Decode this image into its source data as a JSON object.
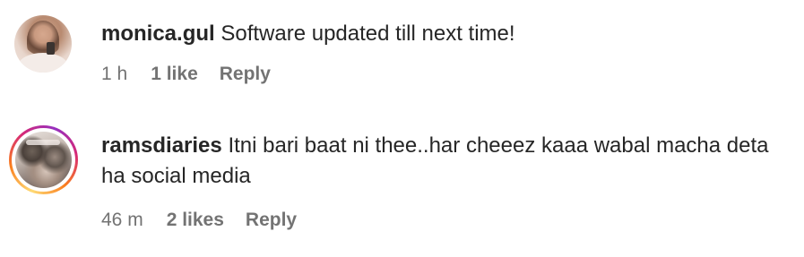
{
  "comments": [
    {
      "username": "monica.gul",
      "text": "Software updated till next time!",
      "time": "1 h",
      "likes": "1 like",
      "reply": "Reply"
    },
    {
      "username": "ramsdiaries",
      "text": "Itni bari baat ni thee..har cheeez kaaa wabal macha deta ha social media",
      "time": "46 m",
      "likes": "2 likes",
      "reply": "Reply",
      "has_story_ring": true
    }
  ],
  "colors": {
    "text": "#262626",
    "meta": "#737373",
    "story_ring": [
      "#feda75",
      "#fa7e1e",
      "#d62976",
      "#962fbf"
    ]
  }
}
